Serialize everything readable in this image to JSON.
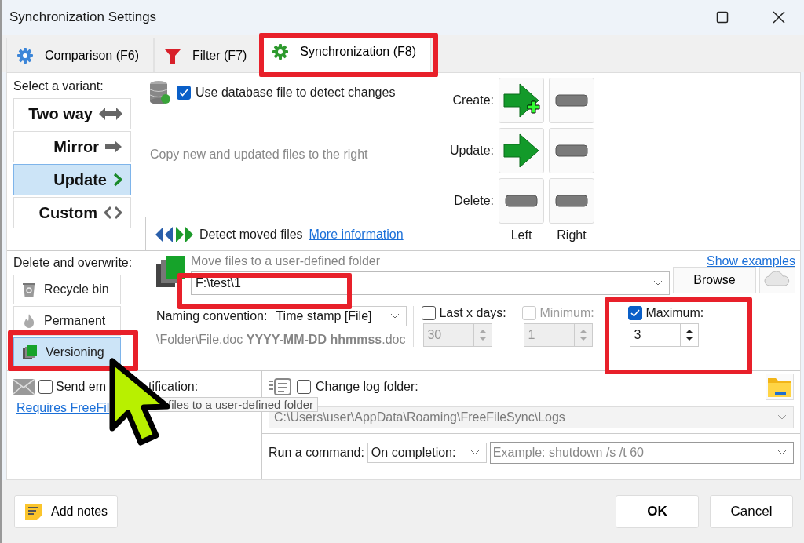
{
  "window": {
    "title": "Synchronization Settings"
  },
  "tabs": [
    {
      "label": "Comparison (F6)",
      "kind": "gear",
      "selected": false
    },
    {
      "label": "Filter (F7)",
      "kind": "funnel",
      "selected": false
    },
    {
      "label": "Synchronization (F8)",
      "kind": "cog",
      "selected": true
    }
  ],
  "variants": {
    "label": "Select a variant:",
    "items": [
      {
        "label": "Two way",
        "kind": "both",
        "selected": false
      },
      {
        "label": "Mirror",
        "kind": "right",
        "selected": false
      },
      {
        "label": "Update",
        "kind": "update",
        "selected": true
      },
      {
        "label": "Custom",
        "kind": "custom",
        "selected": false
      }
    ]
  },
  "database": {
    "label": "Use database file to detect changes",
    "checked": true
  },
  "description": "Copy new and updated files to the right",
  "detect_moved": {
    "label": "Detect moved files",
    "link": "More information"
  },
  "actions": {
    "rows": [
      {
        "label": "Create:",
        "cells": [
          {
            "kind": "create"
          },
          {
            "kind": "none"
          }
        ]
      },
      {
        "label": "Update:",
        "cells": [
          {
            "kind": "update"
          },
          {
            "kind": "none"
          }
        ]
      },
      {
        "label": "Delete:",
        "cells": [
          {
            "kind": "none"
          },
          {
            "kind": "none"
          }
        ]
      }
    ],
    "columns": [
      "Left",
      "Right"
    ]
  },
  "deletion": {
    "label": "Delete and overwrite:",
    "items": [
      {
        "label": "Recycle bin",
        "kind": "recycle",
        "selected": false
      },
      {
        "label": "Permanent",
        "kind": "flame",
        "selected": false
      },
      {
        "label": "Versioning",
        "kind": "versions",
        "selected": true
      }
    ]
  },
  "versioning": {
    "label": "Move files to a user-defined folder",
    "value": "F:\\test\\1",
    "link": "Show examples",
    "browse": "Browse",
    "naming_label": "Naming convention:",
    "naming_value": "Time stamp [File]",
    "example": "\\Folder\\File.doc **YYYY-MM-DD hhmmss**.doc",
    "limits": [
      {
        "label": "Last x days:",
        "checked": false,
        "disabled": false,
        "value": "30"
      },
      {
        "label": "Minimum:",
        "checked": false,
        "disabled": true,
        "value": "1"
      },
      {
        "label": "Maximum:",
        "checked": true,
        "disabled": false,
        "value": "3"
      }
    ]
  },
  "email": {
    "label": "Send em",
    "label_rest": "tification:",
    "checked": false,
    "link": "Requires FreeFil"
  },
  "log": {
    "label": "Change log folder:",
    "checked": false,
    "path": "C:\\Users\\user\\AppData\\Roaming\\FreeFileSync\\Logs"
  },
  "command": {
    "label": "Run a command:",
    "when": "On completion:",
    "placeholder": "Example: shutdown /s /t 60"
  },
  "buttons": {
    "notes": "Add notes",
    "ok": "OK",
    "cancel": "Cancel"
  },
  "tooltip": "files to a user-defined folder"
}
